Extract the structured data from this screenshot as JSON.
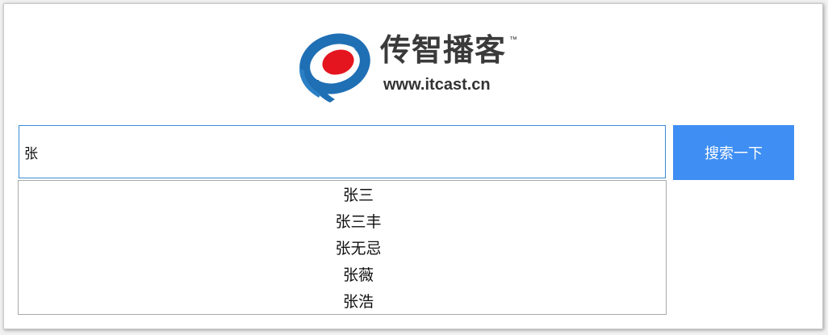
{
  "brand": {
    "name_cn": "传智播客",
    "trademark": "™",
    "url": "www.itcast.cn",
    "colors": {
      "blue": "#1f6fb5",
      "red": "#e4151f"
    }
  },
  "search": {
    "query": "张",
    "button_label": "搜索一下",
    "button_color": "#3f8ef3",
    "input_border_color": "#3d8ad6"
  },
  "suggestions": [
    {
      "label": "张三"
    },
    {
      "label": "张三丰"
    },
    {
      "label": "张无忌"
    },
    {
      "label": "张薇"
    },
    {
      "label": "张浩"
    }
  ]
}
